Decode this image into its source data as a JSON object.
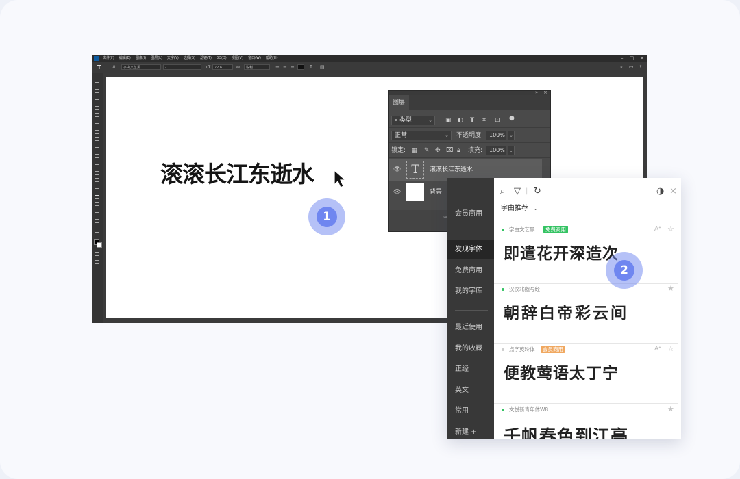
{
  "photoshop": {
    "menu": [
      "文件(F)",
      "编辑(E)",
      "图像(I)",
      "图层(L)",
      "文字(Y)",
      "选择(S)",
      "滤镜(T)",
      "3D(D)",
      "视图(V)",
      "窗口(W)",
      "帮助(H)"
    ],
    "options": {
      "font_family": "字由文艺黑",
      "font_style": "-",
      "font_size": "72.6",
      "aa_mode": "锐利"
    },
    "canvas_text": "滚滚长江东逝水"
  },
  "layers_panel": {
    "tab": "图层",
    "filter_kind": "类型",
    "blend_mode": "正常",
    "opacity_label": "不透明度:",
    "opacity_value": "100%",
    "lock_label": "锁定:",
    "fill_label": "填充:",
    "fill_value": "100%",
    "layers": [
      {
        "name": "滚滚长江东逝水",
        "type": "text",
        "thumb_glyph": "T"
      },
      {
        "name": "背景",
        "type": "background"
      }
    ]
  },
  "font_plugin": {
    "sidebar": [
      "会员商用",
      "发现字体",
      "免费商用",
      "我的字库",
      "最近使用",
      "我的收藏",
      "正经",
      "英文",
      "常用",
      "新建 +"
    ],
    "active_sidebar": "发现字体",
    "dropdown": "字由推荐",
    "fonts": [
      {
        "name": "字由文艺黑",
        "badge": "免费商用",
        "badge_type": "free",
        "sample": "即遣花开深造次",
        "status_color": "#34c363"
      },
      {
        "name": "汉仪北魏写经",
        "badge": "",
        "badge_type": "none",
        "sample": "朝辞白帝彩云间",
        "status_color": "#34c363"
      },
      {
        "name": "点字英玲体",
        "badge": "会员商用",
        "badge_type": "vip",
        "sample": "便教莺语太丁宁",
        "status_color": "#cccccc"
      },
      {
        "name": "文悦新青年体W8",
        "badge": "",
        "badge_type": "none",
        "sample": "千帆春色到江亭",
        "status_color": "#34c363"
      }
    ]
  },
  "steps": [
    "1",
    "2"
  ]
}
